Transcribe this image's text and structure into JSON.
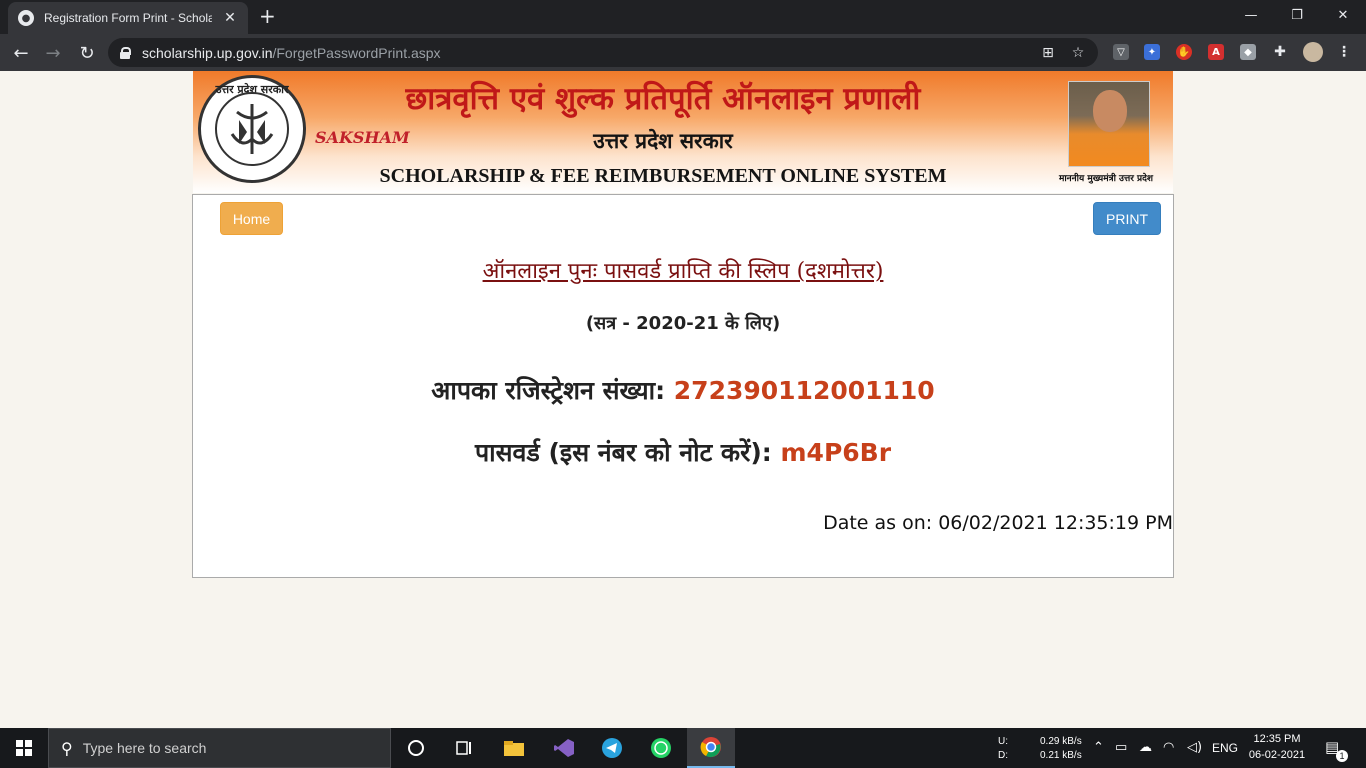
{
  "browser": {
    "tab_title": "Registration Form Print - Scholars",
    "tab_close": "✕",
    "new_tab": "+",
    "url_host": "scholarship.up.gov.in",
    "url_path": "/ForgetPasswordPrint.aspx",
    "minimize": "—",
    "maximize": "❐",
    "close": "✕"
  },
  "banner": {
    "hindi_title": "छात्रवृत्ति एवं शुल्क प्रतिपूर्ति ऑनलाइन प्रणाली",
    "hindi_subtitle": "उत्तर प्रदेश सरकार",
    "saksham": "SAKSHAM",
    "english_title": "SCHOLARSHIP & FEE REIMBURSEMENT ONLINE SYSTEM",
    "emblem_text": "उत्तर प्रदेश सरकार",
    "cm_caption": "माननीय मुख्यमंत्री उत्तर प्रदेश"
  },
  "page": {
    "home_label": "Home",
    "print_label": "PRINT",
    "slip_title": "ऑनलाइन पुनः पासवर्ड प्राप्ति की स्लिप (दशमोत्तर)",
    "session": "(सत्र - 2020-21 के लिए)",
    "registration_label": "आपका रजिस्ट्रेशन संख्या:",
    "registration_number": "272390112001110",
    "password_label": "पासवर्ड (इस नंबर को नोट करें):",
    "password_value": "m4P6Br",
    "date_label": "Date as on:",
    "date_value": "06/02/2021 12:35:19 PM"
  },
  "taskbar": {
    "search_placeholder": "Type here to search",
    "upload_label": "U:",
    "download_label": "D:",
    "upload_speed": "0.29 kB/s",
    "download_speed": "0.21 kB/s",
    "language": "ENG",
    "time": "12:35 PM",
    "date": "06-02-2021",
    "notification_count": "1"
  },
  "colors": {
    "value_accent": "#c7401a",
    "home_button": "#f0ad4e",
    "print_button": "#428bca"
  }
}
